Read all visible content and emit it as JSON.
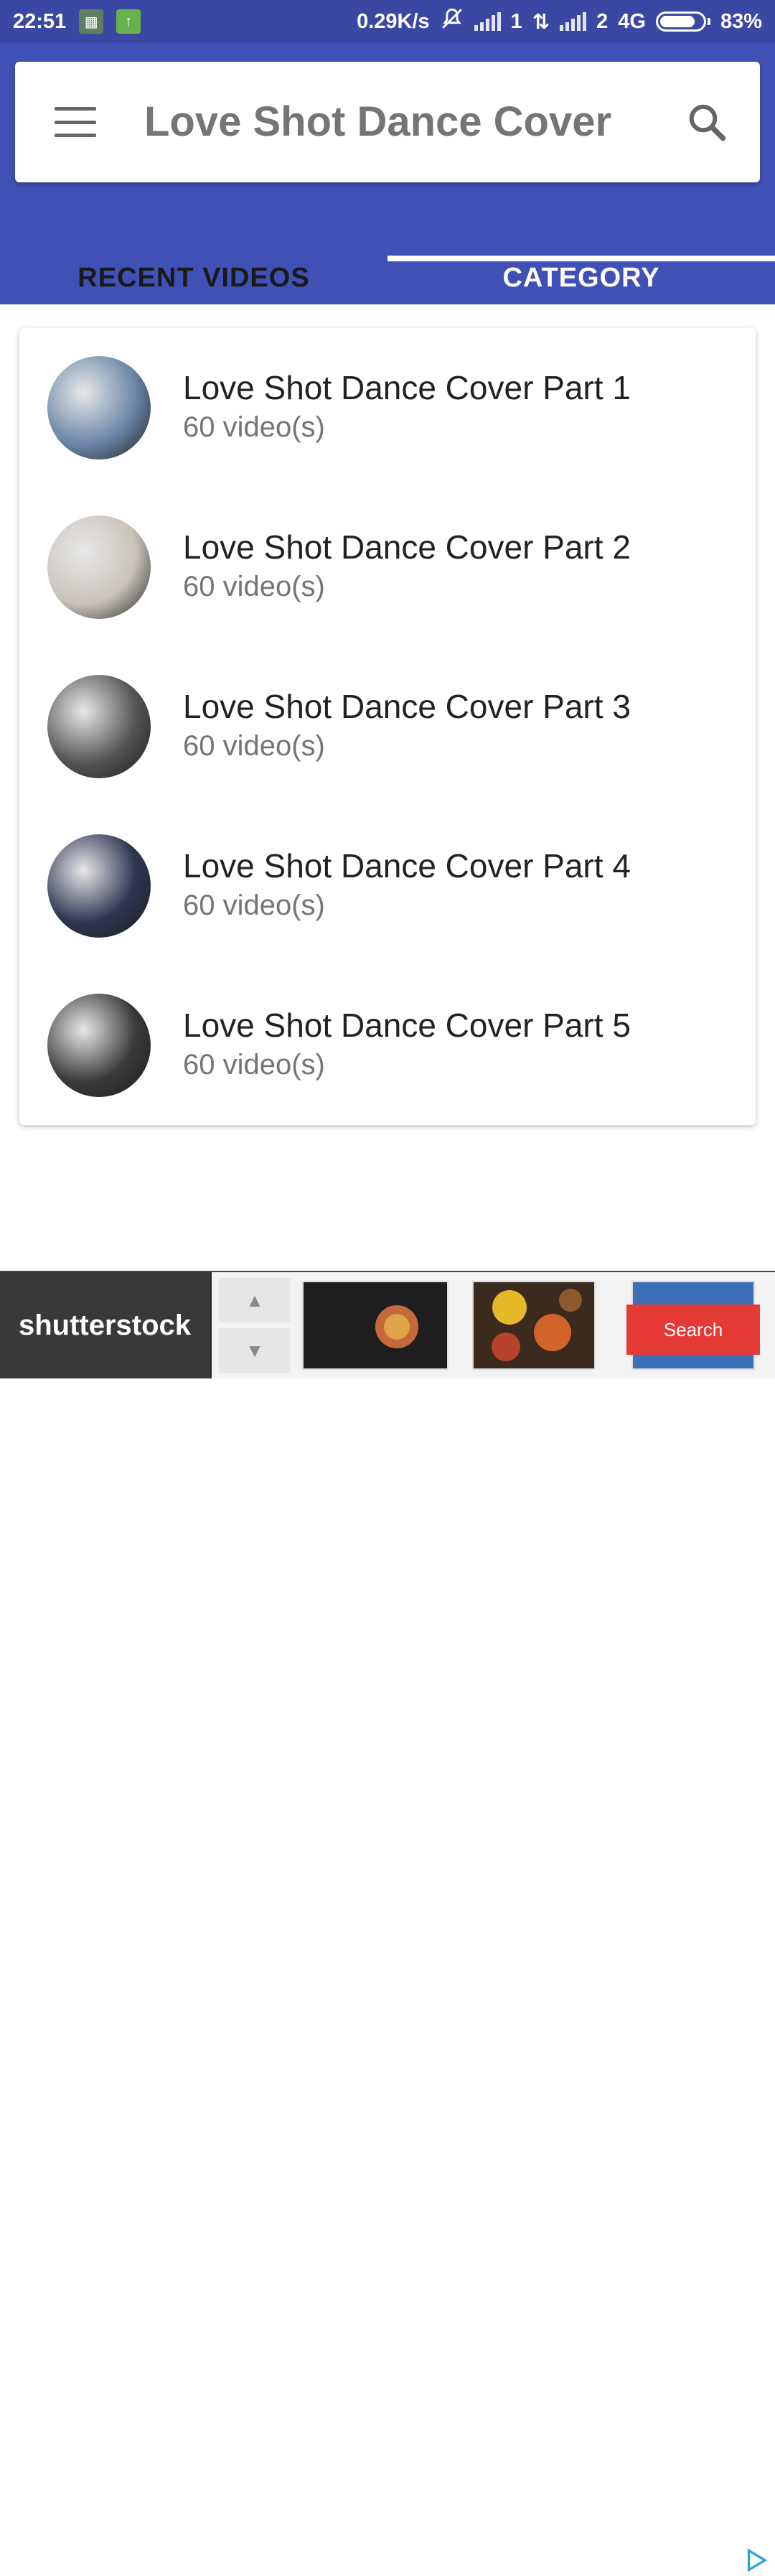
{
  "status_bar": {
    "time": "22:51",
    "net_speed": "0.29K/s",
    "sim1": "1",
    "sim2": "2",
    "network": "4G",
    "battery": "83%",
    "battery_level": 0.83
  },
  "app": {
    "title": "Love Shot Dance Cover",
    "icons": {
      "menu": "menu-icon",
      "search": "search-icon"
    }
  },
  "tabs": [
    {
      "label": "RECENT VIDEOS",
      "active": false
    },
    {
      "label": "CATEGORY",
      "active": true
    }
  ],
  "categories": [
    {
      "title": "Love Shot Dance Cover Part 1",
      "count": "60 video(s)",
      "thumb_color": "#6b86a8"
    },
    {
      "title": "Love Shot Dance Cover Part 2",
      "count": "60 video(s)",
      "thumb_color": "#c9c3bb"
    },
    {
      "title": "Love Shot Dance Cover Part 3",
      "count": "60 video(s)",
      "thumb_color": "#555555"
    },
    {
      "title": "Love Shot Dance Cover Part 4",
      "count": "60 video(s)",
      "thumb_color": "#2e3550"
    },
    {
      "title": "Love Shot Dance Cover Part 5",
      "count": "60 video(s)",
      "thumb_color": "#3a3a3a"
    }
  ],
  "ad": {
    "brand": "shutterstock",
    "cta": "Search"
  },
  "colors": {
    "status_bar": "#3949a3",
    "app_bar": "#3f51b5",
    "ad_cta": "#e53935"
  }
}
